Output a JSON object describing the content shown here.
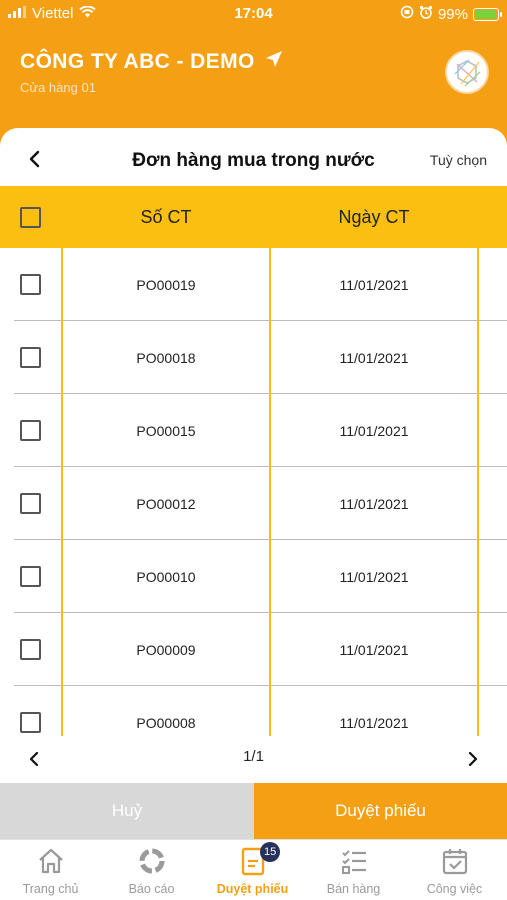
{
  "status_bar": {
    "carrier": "Viettel",
    "time": "17:04",
    "battery": "99%",
    "battery_level": 0.99
  },
  "header": {
    "company": "CÔNG TY ABC - DEMO",
    "store": "Cửa hàng 01"
  },
  "nav": {
    "title": "Đơn hàng mua trong nước",
    "options": "Tuỳ chọn"
  },
  "table": {
    "columns": [
      "Số CT",
      "Ngày CT"
    ],
    "rows": [
      {
        "doc_no": "PO00019",
        "date": "11/01/2021"
      },
      {
        "doc_no": "PO00018",
        "date": "11/01/2021"
      },
      {
        "doc_no": "PO00015",
        "date": "11/01/2021"
      },
      {
        "doc_no": "PO00012",
        "date": "11/01/2021"
      },
      {
        "doc_no": "PO00010",
        "date": "11/01/2021"
      },
      {
        "doc_no": "PO00009",
        "date": "11/01/2021"
      },
      {
        "doc_no": "PO00008",
        "date": "11/01/2021"
      }
    ]
  },
  "pager": {
    "page": "1/1"
  },
  "actions": {
    "cancel": "Huỷ",
    "approve": "Duyệt phiếu"
  },
  "tabbar": {
    "tabs": [
      {
        "label": "Trang chủ",
        "icon": "home-icon"
      },
      {
        "label": "Báo cáo",
        "icon": "report-icon"
      },
      {
        "label": "Duyệt phiếu",
        "icon": "document-icon",
        "badge": "15"
      },
      {
        "label": "Bán hàng",
        "icon": "checklist-icon"
      },
      {
        "label": "Công việc",
        "icon": "calendar-icon"
      }
    ],
    "active_index": 2
  },
  "colors": {
    "accent": "#f5a014",
    "table_header": "#fbbf12",
    "badge": "#26325b"
  }
}
